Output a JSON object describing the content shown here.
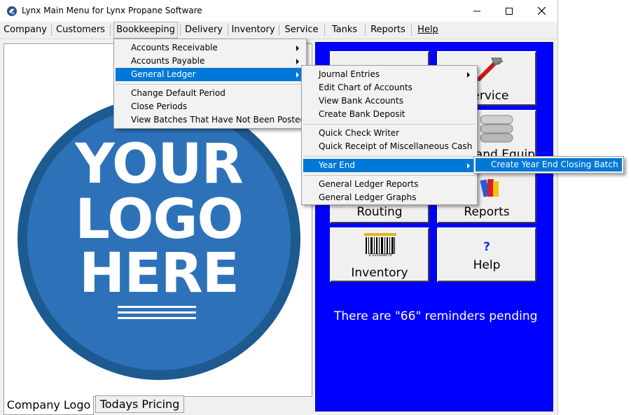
{
  "window": {
    "title": "Lynx Main Menu for Lynx Propane Software",
    "caption_buttons": {
      "minimize": "—",
      "maximize": "☐",
      "close": "✕"
    }
  },
  "menubar": {
    "items": [
      "Company",
      "Customers",
      "Bookkeeping",
      "Delivery",
      "Inventory",
      "Service",
      "Tanks",
      "Reports",
      "Help"
    ],
    "open_item": "Bookkeeping"
  },
  "bookkeeping_menu": {
    "items": [
      "Accounts Receivable",
      "Accounts Payable",
      "General Ledger",
      "Change Default Period",
      "Close Periods",
      "View Batches That Have Not Been Posted"
    ],
    "selected": "General Ledger"
  },
  "general_ledger_menu": {
    "items": [
      "Journal Entries",
      "Edit Chart of Accounts",
      "View Bank Accounts",
      "Create Bank Deposit",
      "Quick Check Writer",
      "Quick Receipt of Miscellaneous Cash",
      "Year End",
      "General Ledger Reports",
      "General Ledger Graphs"
    ],
    "selected": "Year End"
  },
  "year_end_menu": {
    "items": [
      "Create Year End Closing Batch"
    ],
    "selected": "Create Year End Closing Batch"
  },
  "logo": {
    "line1": "YOUR",
    "line2": "LOGO",
    "line3": "HERE"
  },
  "tabs": [
    "Company Logo",
    "Todays Pricing"
  ],
  "tiles": {
    "service": "Service",
    "tanks": "Tanks and Equip",
    "routing": "Routing",
    "reports": "Reports",
    "inventory": "Inventory",
    "help": "Help",
    "help_symbol": "?",
    "barcode_digits": "9 225028678"
  },
  "reminders": "There are \"66\" reminders pending",
  "icons": {
    "app": "lynx-app-icon",
    "service": "wrench-icon",
    "tanks": "propane-tanks-icon",
    "reports": "books-icon",
    "inventory": "barcode-icon",
    "help": "question-mark-icon"
  },
  "colors": {
    "menu_highlight": "#0078d7",
    "tile_panel": "#0000ff",
    "logo_blue": "#2d72b8"
  }
}
